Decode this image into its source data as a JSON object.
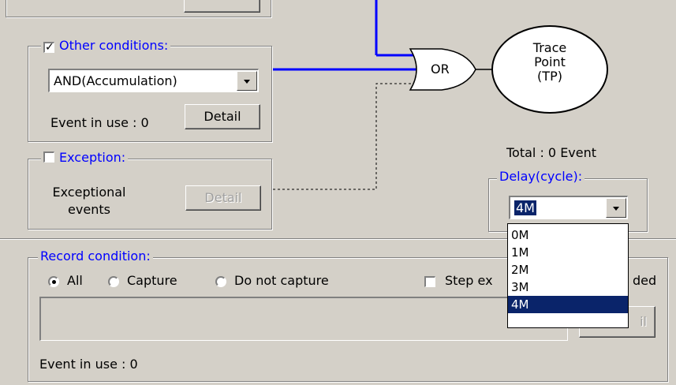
{
  "top_box": {},
  "other_conditions": {
    "legend": "Other conditions:",
    "checked": true,
    "combo_value": "AND(Accumulation)",
    "event_in_use": "Event in use : 0",
    "detail_label": "Detail"
  },
  "exception": {
    "legend": "Exception:",
    "checked": false,
    "desc_line1": "Exceptional",
    "desc_line2": "events",
    "detail_label": "Detail"
  },
  "diagram": {
    "gate_label": "OR",
    "trace_line1": "Trace",
    "trace_line2": "Point",
    "trace_line3": "(TP)"
  },
  "total": "Total : 0  Event",
  "delay": {
    "legend": "Delay(cycle):",
    "value": "4M",
    "options": [
      "0M",
      "1M",
      "2M",
      "3M",
      "4M"
    ],
    "selected_index": 4
  },
  "record": {
    "legend": "Record condition:",
    "radios": [
      {
        "label": "All",
        "checked": true
      },
      {
        "label": "Capture",
        "checked": false
      },
      {
        "label": "Do not capture",
        "checked": false
      }
    ],
    "step_label_left": "Step ex",
    "step_label_right": "ded",
    "detail_label_partial": "il",
    "event_in_use": "Event in use : 0"
  },
  "colors": {
    "background": "#d4d0c8",
    "accent_blue": "#0000ff",
    "selection": "#0a246a"
  }
}
